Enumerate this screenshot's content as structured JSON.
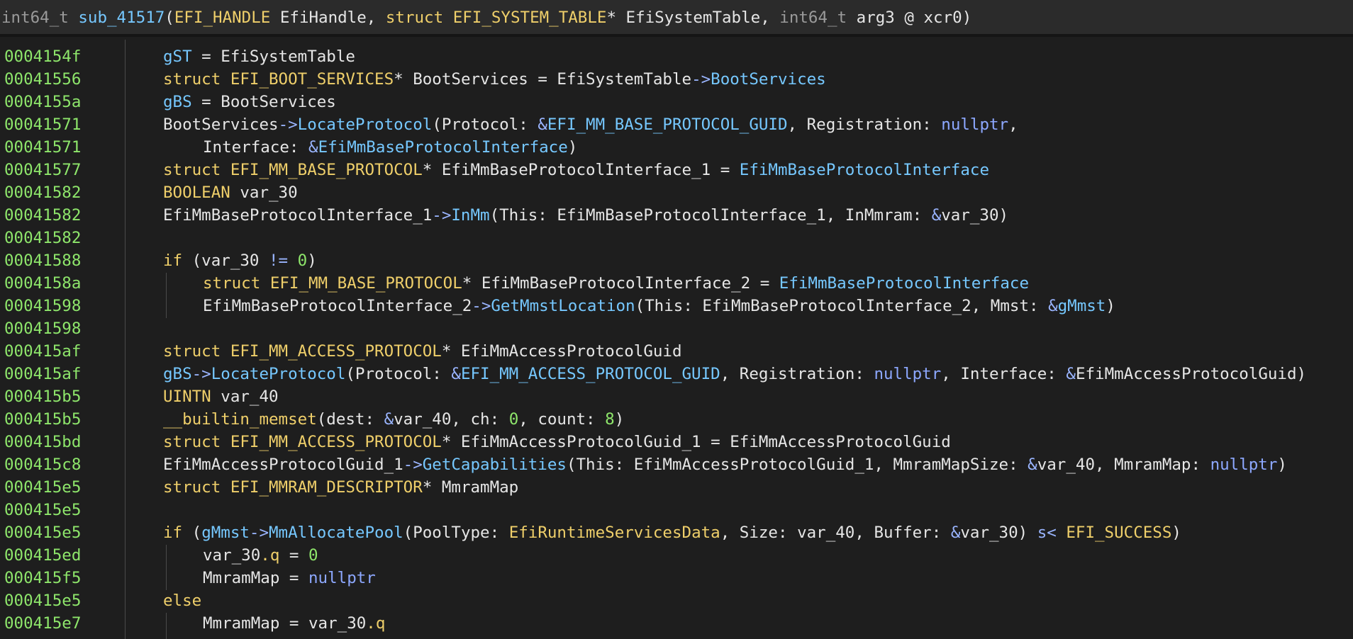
{
  "header": {
    "tokens": [
      {
        "t": "int64_t ",
        "c": "tk-dim"
      },
      {
        "t": "sub_41517",
        "c": "tk-fn"
      },
      {
        "t": "(",
        "c": "tk-punct"
      },
      {
        "t": "EFI_HANDLE",
        "c": "tk-type"
      },
      {
        "t": " EfiHandle, ",
        "c": "tk-var"
      },
      {
        "t": "struct ",
        "c": "tk-type"
      },
      {
        "t": "EFI_SYSTEM_TABLE",
        "c": "tk-type"
      },
      {
        "t": "* EfiSystemTable, ",
        "c": "tk-var"
      },
      {
        "t": "int64_t ",
        "c": "tk-dim"
      },
      {
        "t": "arg3 @ xcr0",
        "c": "tk-var"
      },
      {
        "t": ")",
        "c": "tk-punct"
      }
    ]
  },
  "lines": [
    {
      "addr": "0004154f",
      "indent": 0,
      "tokens": [
        {
          "t": "gST",
          "c": "tk-g"
        },
        {
          "t": " = EfiSystemTable",
          "c": "tk-var"
        }
      ]
    },
    {
      "addr": "00041556",
      "indent": 0,
      "tokens": [
        {
          "t": "struct ",
          "c": "tk-kw"
        },
        {
          "t": "EFI_BOOT_SERVICES",
          "c": "tk-type"
        },
        {
          "t": "* BootServices = EfiSystemTable",
          "c": "tk-var"
        },
        {
          "t": "->",
          "c": "tk-op"
        },
        {
          "t": "BootServices",
          "c": "tk-fn"
        }
      ]
    },
    {
      "addr": "0004155a",
      "indent": 0,
      "tokens": [
        {
          "t": "gBS",
          "c": "tk-g"
        },
        {
          "t": " = BootServices",
          "c": "tk-var"
        }
      ]
    },
    {
      "addr": "00041571",
      "indent": 0,
      "tokens": [
        {
          "t": "BootServices",
          "c": "tk-var"
        },
        {
          "t": "->",
          "c": "tk-op"
        },
        {
          "t": "LocateProtocol",
          "c": "tk-fn"
        },
        {
          "t": "(Protocol: ",
          "c": "tk-var"
        },
        {
          "t": "&",
          "c": "tk-op"
        },
        {
          "t": "EFI_MM_BASE_PROTOCOL_GUID",
          "c": "tk-g"
        },
        {
          "t": ", Registration: ",
          "c": "tk-var"
        },
        {
          "t": "nullptr",
          "c": "tk-const"
        },
        {
          "t": ",",
          "c": "tk-var"
        }
      ]
    },
    {
      "addr": "00041571",
      "indent": 1,
      "tokens": [
        {
          "t": "Interface: ",
          "c": "tk-var"
        },
        {
          "t": "&",
          "c": "tk-op"
        },
        {
          "t": "EfiMmBaseProtocolInterface",
          "c": "tk-g"
        },
        {
          "t": ")",
          "c": "tk-var"
        }
      ]
    },
    {
      "addr": "00041577",
      "indent": 0,
      "tokens": [
        {
          "t": "struct ",
          "c": "tk-kw"
        },
        {
          "t": "EFI_MM_BASE_PROTOCOL",
          "c": "tk-type"
        },
        {
          "t": "* EfiMmBaseProtocolInterface_1 = ",
          "c": "tk-var"
        },
        {
          "t": "EfiMmBaseProtocolInterface",
          "c": "tk-g"
        }
      ]
    },
    {
      "addr": "00041582",
      "indent": 0,
      "tokens": [
        {
          "t": "BOOLEAN",
          "c": "tk-type"
        },
        {
          "t": " var_30",
          "c": "tk-var"
        }
      ]
    },
    {
      "addr": "00041582",
      "indent": 0,
      "tokens": [
        {
          "t": "EfiMmBaseProtocolInterface_1",
          "c": "tk-var"
        },
        {
          "t": "->",
          "c": "tk-op"
        },
        {
          "t": "InMm",
          "c": "tk-fn"
        },
        {
          "t": "(This: EfiMmBaseProtocolInterface_1, InMmram: ",
          "c": "tk-var"
        },
        {
          "t": "&",
          "c": "tk-op"
        },
        {
          "t": "var_30)",
          "c": "tk-var"
        }
      ]
    },
    {
      "addr": "00041582",
      "indent": 0,
      "tokens": []
    },
    {
      "addr": "00041588",
      "indent": 0,
      "tokens": [
        {
          "t": "if ",
          "c": "tk-kw"
        },
        {
          "t": "(var_30 ",
          "c": "tk-var"
        },
        {
          "t": "!=",
          "c": "tk-op"
        },
        {
          "t": " ",
          "c": "tk-var"
        },
        {
          "t": "0",
          "c": "tk-num"
        },
        {
          "t": ")",
          "c": "tk-var"
        }
      ]
    },
    {
      "addr": "0004158a",
      "indent": 1,
      "tokens": [
        {
          "t": "struct ",
          "c": "tk-kw"
        },
        {
          "t": "EFI_MM_BASE_PROTOCOL",
          "c": "tk-type"
        },
        {
          "t": "* EfiMmBaseProtocolInterface_2 = ",
          "c": "tk-var"
        },
        {
          "t": "EfiMmBaseProtocolInterface",
          "c": "tk-g"
        }
      ]
    },
    {
      "addr": "00041598",
      "indent": 1,
      "tokens": [
        {
          "t": "EfiMmBaseProtocolInterface_2",
          "c": "tk-var"
        },
        {
          "t": "->",
          "c": "tk-op"
        },
        {
          "t": "GetMmstLocation",
          "c": "tk-fn"
        },
        {
          "t": "(This: EfiMmBaseProtocolInterface_2, Mmst: ",
          "c": "tk-var"
        },
        {
          "t": "&",
          "c": "tk-op"
        },
        {
          "t": "gMmst",
          "c": "tk-g"
        },
        {
          "t": ")",
          "c": "tk-var"
        }
      ]
    },
    {
      "addr": "00041598",
      "indent": 0,
      "tokens": []
    },
    {
      "addr": "000415af",
      "indent": 0,
      "tokens": [
        {
          "t": "struct ",
          "c": "tk-kw"
        },
        {
          "t": "EFI_MM_ACCESS_PROTOCOL",
          "c": "tk-type"
        },
        {
          "t": "* EfiMmAccessProtocolGuid",
          "c": "tk-var"
        }
      ]
    },
    {
      "addr": "000415af",
      "indent": 0,
      "tokens": [
        {
          "t": "gBS",
          "c": "tk-g"
        },
        {
          "t": "->",
          "c": "tk-op"
        },
        {
          "t": "LocateProtocol",
          "c": "tk-fn"
        },
        {
          "t": "(Protocol: ",
          "c": "tk-var"
        },
        {
          "t": "&",
          "c": "tk-op"
        },
        {
          "t": "EFI_MM_ACCESS_PROTOCOL_GUID",
          "c": "tk-g"
        },
        {
          "t": ", Registration: ",
          "c": "tk-var"
        },
        {
          "t": "nullptr",
          "c": "tk-const"
        },
        {
          "t": ", Interface: ",
          "c": "tk-var"
        },
        {
          "t": "&",
          "c": "tk-op"
        },
        {
          "t": "EfiMmAccessProtocolGuid)",
          "c": "tk-var"
        }
      ]
    },
    {
      "addr": "000415b5",
      "indent": 0,
      "tokens": [
        {
          "t": "UINTN",
          "c": "tk-type"
        },
        {
          "t": " var_40",
          "c": "tk-var"
        }
      ]
    },
    {
      "addr": "000415b5",
      "indent": 0,
      "tokens": [
        {
          "t": "__builtin_memset",
          "c": "tk-type"
        },
        {
          "t": "(dest: ",
          "c": "tk-var"
        },
        {
          "t": "&",
          "c": "tk-op"
        },
        {
          "t": "var_40, ch: ",
          "c": "tk-var"
        },
        {
          "t": "0",
          "c": "tk-num"
        },
        {
          "t": ", count: ",
          "c": "tk-var"
        },
        {
          "t": "8",
          "c": "tk-num"
        },
        {
          "t": ")",
          "c": "tk-var"
        }
      ]
    },
    {
      "addr": "000415bd",
      "indent": 0,
      "tokens": [
        {
          "t": "struct ",
          "c": "tk-kw"
        },
        {
          "t": "EFI_MM_ACCESS_PROTOCOL",
          "c": "tk-type"
        },
        {
          "t": "* EfiMmAccessProtocolGuid_1 = EfiMmAccessProtocolGuid",
          "c": "tk-var"
        }
      ]
    },
    {
      "addr": "000415c8",
      "indent": 0,
      "tokens": [
        {
          "t": "EfiMmAccessProtocolGuid_1",
          "c": "tk-var"
        },
        {
          "t": "->",
          "c": "tk-op"
        },
        {
          "t": "GetCapabilities",
          "c": "tk-fn"
        },
        {
          "t": "(This: EfiMmAccessProtocolGuid_1, MmramMapSize: ",
          "c": "tk-var"
        },
        {
          "t": "&",
          "c": "tk-op"
        },
        {
          "t": "var_40, MmramMap: ",
          "c": "tk-var"
        },
        {
          "t": "nullptr",
          "c": "tk-const"
        },
        {
          "t": ")",
          "c": "tk-var"
        }
      ]
    },
    {
      "addr": "000415e5",
      "indent": 0,
      "tokens": [
        {
          "t": "struct ",
          "c": "tk-kw"
        },
        {
          "t": "EFI_MMRAM_DESCRIPTOR",
          "c": "tk-type"
        },
        {
          "t": "* MmramMap",
          "c": "tk-var"
        }
      ]
    },
    {
      "addr": "000415e5",
      "indent": 0,
      "tokens": []
    },
    {
      "addr": "000415e5",
      "indent": 0,
      "tokens": [
        {
          "t": "if ",
          "c": "tk-kw"
        },
        {
          "t": "(",
          "c": "tk-var"
        },
        {
          "t": "gMmst",
          "c": "tk-g"
        },
        {
          "t": "->",
          "c": "tk-op"
        },
        {
          "t": "MmAllocatePool",
          "c": "tk-fn"
        },
        {
          "t": "(PoolType: ",
          "c": "tk-var"
        },
        {
          "t": "EfiRuntimeServicesData",
          "c": "tk-type"
        },
        {
          "t": ", Size: var_40, Buffer: ",
          "c": "tk-var"
        },
        {
          "t": "&",
          "c": "tk-op"
        },
        {
          "t": "var_30) ",
          "c": "tk-var"
        },
        {
          "t": "s<",
          "c": "tk-op"
        },
        {
          "t": " ",
          "c": "tk-var"
        },
        {
          "t": "EFI_SUCCESS",
          "c": "tk-type"
        },
        {
          "t": ")",
          "c": "tk-var"
        }
      ]
    },
    {
      "addr": "000415ed",
      "indent": 1,
      "tokens": [
        {
          "t": "var_30",
          "c": "tk-var"
        },
        {
          "t": ".q",
          "c": "tk-type"
        },
        {
          "t": " = ",
          "c": "tk-var"
        },
        {
          "t": "0",
          "c": "tk-num"
        }
      ]
    },
    {
      "addr": "000415f5",
      "indent": 1,
      "tokens": [
        {
          "t": "MmramMap = ",
          "c": "tk-var"
        },
        {
          "t": "nullptr",
          "c": "tk-const"
        }
      ]
    },
    {
      "addr": "000415e5",
      "indent": 0,
      "tokens": [
        {
          "t": "else",
          "c": "tk-kw"
        }
      ]
    },
    {
      "addr": "000415e7",
      "indent": 1,
      "tokens": [
        {
          "t": "MmramMap = var_30",
          "c": "tk-var"
        },
        {
          "t": ".q",
          "c": "tk-type"
        }
      ]
    }
  ]
}
